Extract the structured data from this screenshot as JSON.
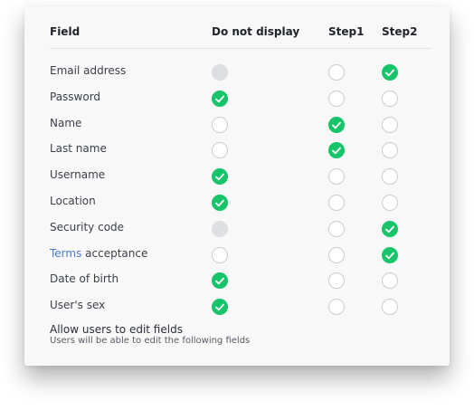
{
  "colors": {
    "checked": "#17c46a",
    "disabled": "#dedfe2",
    "link": "#4a7bd0"
  },
  "table": {
    "columns": {
      "field": "Field",
      "do_not_display": "Do not display",
      "step1": "Step1",
      "step2": "Step2"
    },
    "rows": [
      {
        "label": "Email address",
        "dnd": "disabled",
        "step1": "empty",
        "step2": "checked"
      },
      {
        "label": "Password",
        "dnd": "checked",
        "step1": "empty",
        "step2": "empty"
      },
      {
        "label": "Name",
        "dnd": "empty",
        "step1": "checked",
        "step2": "empty"
      },
      {
        "label": "Last name",
        "dnd": "empty",
        "step1": "checked",
        "step2": "empty"
      },
      {
        "label": "Username",
        "dnd": "checked",
        "step1": "empty",
        "step2": "empty"
      },
      {
        "label": "Location",
        "dnd": "checked",
        "step1": "empty",
        "step2": "empty"
      },
      {
        "label": "Security code",
        "dnd": "disabled",
        "step1": "empty",
        "step2": "checked"
      },
      {
        "label": "acceptance",
        "link": "Terms",
        "dnd": "empty",
        "step1": "empty",
        "step2": "checked"
      },
      {
        "label": "Date of birth",
        "dnd": "checked",
        "step1": "empty",
        "step2": "empty"
      },
      {
        "label": "User's sex",
        "dnd": "checked",
        "step1": "empty",
        "step2": "empty"
      }
    ]
  },
  "footer": {
    "title": "Allow users to edit fields",
    "subtitle": "Users will be able to edit the following fields"
  }
}
